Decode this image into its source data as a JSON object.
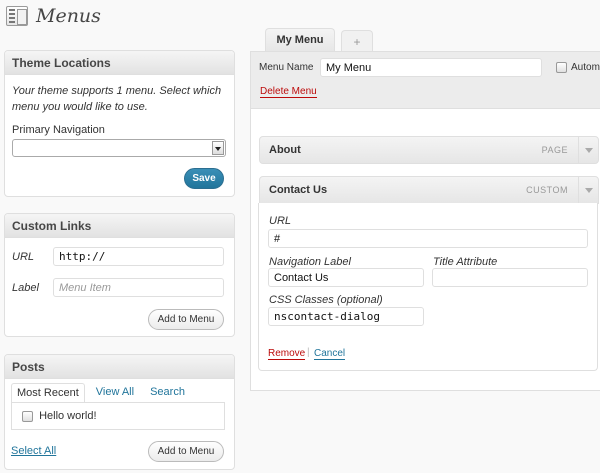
{
  "page": {
    "title": "Menus"
  },
  "theme_locations": {
    "heading": "Theme Locations",
    "help": "Your theme supports 1 menu. Select which menu you would like to use.",
    "primary_label": "Primary Navigation",
    "primary_value": "",
    "save_label": "Save"
  },
  "custom_links": {
    "heading": "Custom Links",
    "url_label": "URL",
    "url_value": "http://",
    "label_label": "Label",
    "label_placeholder": "Menu Item",
    "add_label": "Add to Menu"
  },
  "posts": {
    "heading": "Posts",
    "tabs": [
      "Most Recent",
      "View All",
      "Search"
    ],
    "items": [
      {
        "label": "Hello world!",
        "checked": false
      }
    ],
    "select_all": "Select All",
    "add_label": "Add to Menu"
  },
  "menu_tabs": {
    "active": "My Menu",
    "add": "+"
  },
  "menu_editor": {
    "name_label": "Menu Name",
    "name_value": "My Menu",
    "auto_label": "Autom",
    "delete_label": "Delete Menu"
  },
  "menu_items": [
    {
      "title": "About",
      "type": "PAGE"
    },
    {
      "title": "Contact Us",
      "type": "CUSTOM",
      "url_label": "URL",
      "url_value": "#",
      "nav_label": "Navigation Label",
      "nav_value": "Contact Us",
      "title_attr_label": "Title Attribute",
      "title_attr_value": "",
      "css_label": "CSS Classes (optional)",
      "css_value": "nscontact-dialog",
      "remove_label": "Remove",
      "separator": "|",
      "cancel_label": "Cancel"
    }
  ],
  "colors": {
    "primary": "#21759b",
    "delete": "#bc0b0b",
    "link": "#21759b"
  }
}
